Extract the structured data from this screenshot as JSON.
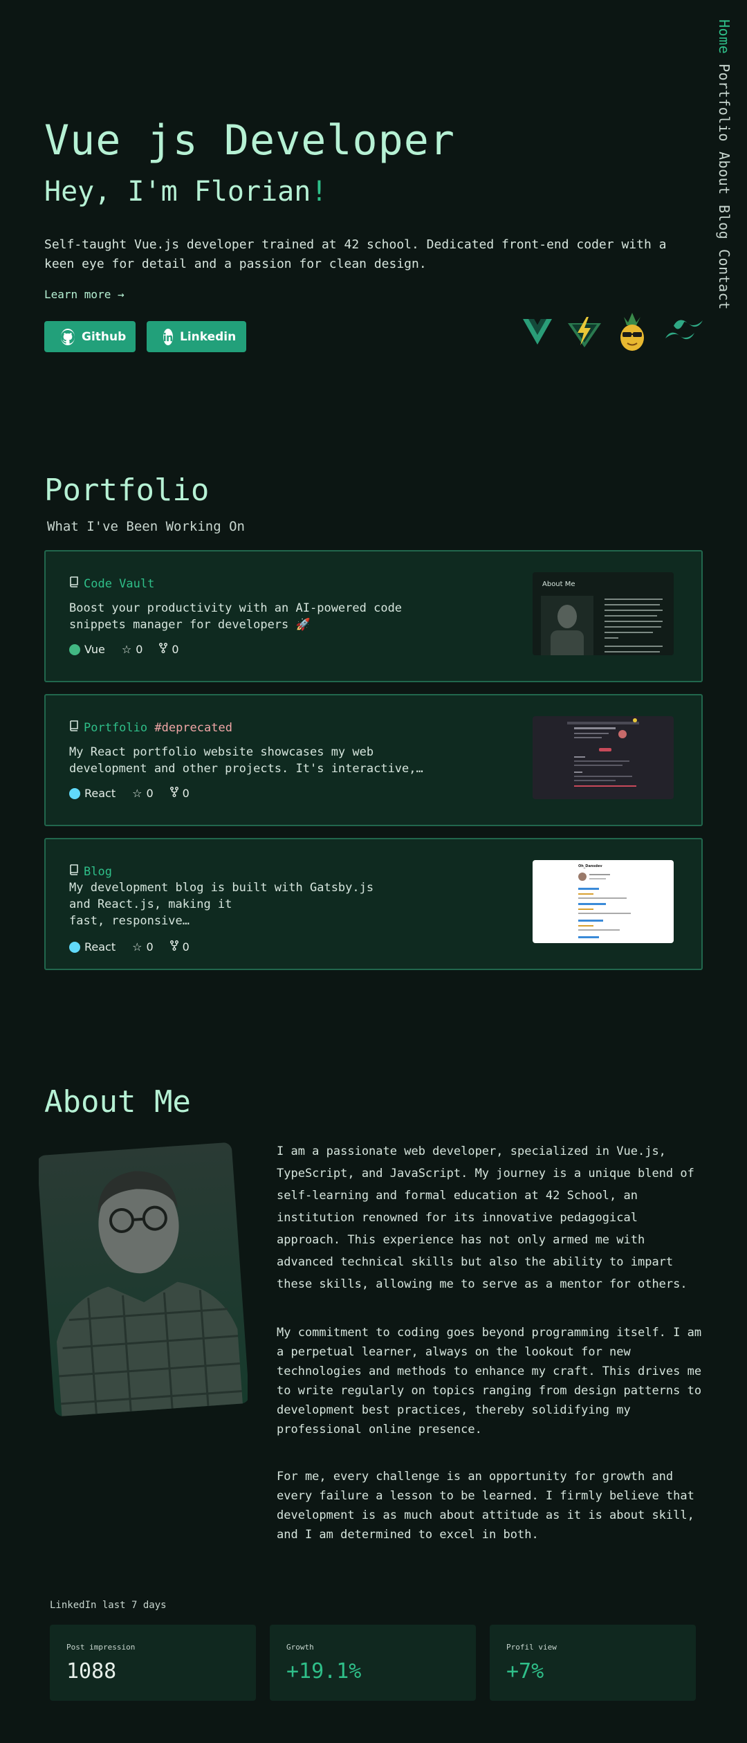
{
  "nav": {
    "items": [
      {
        "label": "Home",
        "active": true
      },
      {
        "label": "Portfolio",
        "active": false
      },
      {
        "label": "About",
        "active": false
      },
      {
        "label": "Blog",
        "active": false
      },
      {
        "label": "Contact",
        "active": false
      }
    ]
  },
  "hero": {
    "title": "Vue js Developer",
    "subtitle": "Hey, I'm Florian",
    "subtitle_mark": "!",
    "description": "Self-taught Vue.js developer trained at 42 school. Dedicated front-end coder with a keen eye for detail and a passion for clean design.",
    "learn_more": "Learn more →",
    "buttons": {
      "github": "Github",
      "linkedin": "Linkedin"
    },
    "tech_icons": [
      "vue-icon",
      "vite-icon",
      "pineapple-avatar-icon",
      "tailwind-icon"
    ]
  },
  "portfolio": {
    "title": "Portfolio",
    "subtitle": "What I've Been Working On",
    "projects": [
      {
        "title": "Code Vault",
        "tag": "",
        "description": "Boost your productivity with an AI-powered code snippets manager for developers 🚀",
        "language": "Vue",
        "language_color": "#42b883",
        "stars": "0",
        "forks": "0",
        "thumb_heading": "About Me"
      },
      {
        "title": "Portfolio ",
        "tag": "#deprecated",
        "description": "My React portfolio website showcases my web development and other projects. It's interactive,…",
        "language": "React",
        "language_color": "#61dafb",
        "stars": "0",
        "forks": "0"
      },
      {
        "title": "Blog",
        "tag": "",
        "description": "My development blog is built with Gatsby.js and React.js, making it\nfast, responsive…",
        "language": "React",
        "language_color": "#61dafb",
        "stars": "0",
        "forks": "0",
        "thumb_heading": "Oh_Dansdev"
      }
    ]
  },
  "about": {
    "title": "About Me",
    "paragraphs": [
      "I am a passionate web developer, specialized in Vue.js, TypeScript, and JavaScript. My journey is a unique blend of self-learning and formal education at 42 School, an institution renowned for its innovative pedagogical approach. This experience has not only armed me with advanced technical skills but also the ability to impart these skills, allowing me to serve as a mentor for others.",
      "My commitment to coding goes beyond programming itself. I am a perpetual learner, always on the lookout for new technologies and methods to enhance my craft. This drives me to write regularly on topics ranging from design patterns to development best practices, thereby solidifying my professional online presence.",
      "For me, every challenge is an opportunity for growth and every failure a lesson to be learned. I firmly believe that development is as much about attitude as it is about skill, and I am determined to excel in both."
    ]
  },
  "linkedin": {
    "label": "LinkedIn last 7 days",
    "stats": [
      {
        "label": "Post impression",
        "value": "1088",
        "color": "#e6efe9"
      },
      {
        "label": "Growth",
        "value": "+19.1%",
        "color": "#2fbf89"
      },
      {
        "label": "Profil view",
        "value": "+7%",
        "color": "#2fbf89"
      }
    ]
  }
}
